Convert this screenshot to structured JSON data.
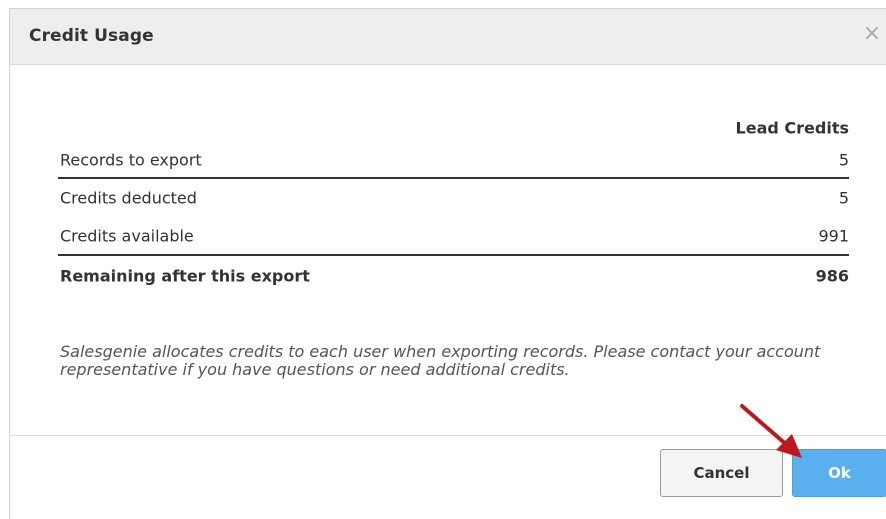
{
  "dialog": {
    "title": "Credit Usage",
    "close_glyph": "×"
  },
  "table": {
    "column_header": "Lead Credits",
    "rows": [
      {
        "label": "Records to export",
        "value": "5"
      },
      {
        "label": "Credits deducted",
        "value": "5"
      },
      {
        "label": "Credits available",
        "value": "991"
      },
      {
        "label": "Remaining after this export",
        "value": "986"
      }
    ]
  },
  "note": "Salesgenie allocates credits to each user when exporting records. Please contact your account representative if you have questions or need additional credits.",
  "buttons": {
    "cancel": "Cancel",
    "ok": "Ok"
  },
  "colors": {
    "header_bg": "#eeeeee",
    "ok_button": "#5aaff0",
    "annotation_arrow": "#c0171c"
  },
  "icons": {
    "close": "close-icon",
    "annotation": "red-arrow-icon"
  }
}
